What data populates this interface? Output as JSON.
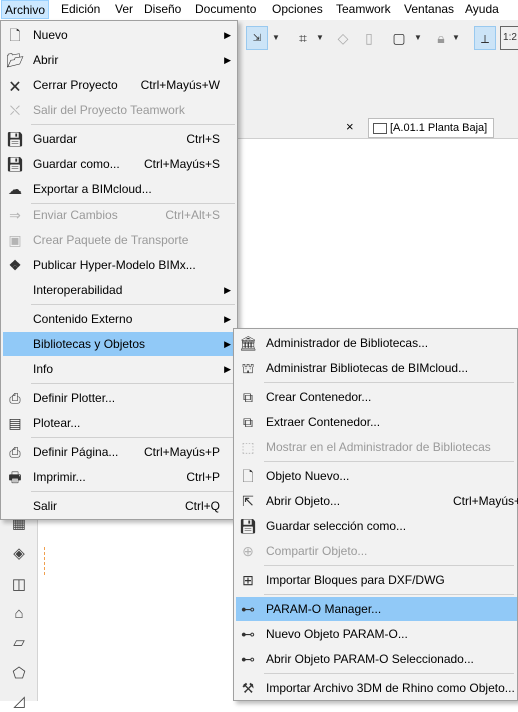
{
  "menubar": {
    "items": [
      {
        "label": "Archivo"
      },
      {
        "label": "Edición"
      },
      {
        "label": "Ver"
      },
      {
        "label": "Diseño"
      },
      {
        "label": "Documento"
      },
      {
        "label": "Opciones"
      },
      {
        "label": "Teamwork"
      },
      {
        "label": "Ventanas"
      },
      {
        "label": "Ayuda"
      }
    ]
  },
  "tab": {
    "close": "×",
    "label": "[A.01.1 Planta Baja]"
  },
  "toolbar": {
    "scale_label": "1:2"
  },
  "archivo_menu": {
    "items": [
      {
        "icon": "document-icon",
        "label": "Nuevo",
        "submenu": true
      },
      {
        "icon": "open-folder-icon",
        "label": "Abrir",
        "submenu": true
      },
      {
        "icon": "close-document-icon",
        "label": "Cerrar Proyecto",
        "shortcut": "Ctrl+Mayús+W"
      },
      {
        "icon": "exit-teamwork-icon",
        "label": "Salir del Proyecto Teamwork",
        "disabled": true
      },
      {
        "icon": "save-icon",
        "label": "Guardar",
        "shortcut": "Ctrl+S"
      },
      {
        "icon": "save-as-icon",
        "label": "Guardar como...",
        "shortcut": "Ctrl+Mayús+S"
      },
      {
        "icon": "export-cloud-icon",
        "label": "Exportar a BIMcloud..."
      },
      {
        "icon": "send-changes-icon",
        "label": "Enviar Cambios",
        "shortcut": "Ctrl+Alt+S",
        "disabled": true
      },
      {
        "icon": "package-icon",
        "label": "Crear Paquete de Transporte",
        "disabled": true
      },
      {
        "icon": "bimx-icon",
        "label": "Publicar Hyper-Modelo BIMx..."
      },
      {
        "label": "Interoperabilidad",
        "submenu": true
      },
      {
        "label": "Contenido Externo",
        "submenu": true
      },
      {
        "label": "Bibliotecas y Objetos",
        "submenu": true
      },
      {
        "label": "Info",
        "submenu": true
      },
      {
        "icon": "plotter-setup-icon",
        "label": "Definir Plotter..."
      },
      {
        "icon": "plot-icon",
        "label": "Plotear..."
      },
      {
        "icon": "page-setup-icon",
        "label": "Definir Página...",
        "shortcut": "Ctrl+Mayús+P"
      },
      {
        "icon": "printer-icon",
        "label": "Imprimir...",
        "shortcut": "Ctrl+P"
      },
      {
        "label": "Salir",
        "shortcut": "Ctrl+Q"
      }
    ]
  },
  "bibliotecas_menu": {
    "items": [
      {
        "icon": "library-manager-icon",
        "label": "Administrador de Bibliotecas..."
      },
      {
        "icon": "bimcloud-library-icon",
        "label": "Administrar Bibliotecas de BIMcloud..."
      },
      {
        "icon": "create-container-icon",
        "label": "Crear Contenedor..."
      },
      {
        "icon": "extract-container-icon",
        "label": "Extraer Contenedor..."
      },
      {
        "icon": "show-in-manager-icon",
        "label": "Mostrar en el Administrador de Bibliotecas",
        "disabled": true
      },
      {
        "icon": "new-object-icon",
        "label": "Objeto Nuevo..."
      },
      {
        "icon": "open-object-icon",
        "label": "Abrir Objeto...",
        "shortcut": "Ctrl+Mayús+"
      },
      {
        "icon": "save-selection-icon",
        "label": "Guardar selección como..."
      },
      {
        "icon": "share-object-icon",
        "label": "Compartir Objeto...",
        "disabled": true
      },
      {
        "icon": "import-dxf-icon",
        "label": "Importar Bloques para DXF/DWG"
      },
      {
        "icon": "param-o-icon",
        "label": "PARAM-O Manager..."
      },
      {
        "icon": "new-param-o-icon",
        "label": "Nuevo Objeto PARAM-O..."
      },
      {
        "icon": "open-param-o-icon",
        "label": "Abrir Objeto PARAM-O Seleccionado..."
      },
      {
        "icon": "rhino-import-icon",
        "label": "Importar Archivo 3DM de Rhino como Objeto..."
      }
    ]
  }
}
